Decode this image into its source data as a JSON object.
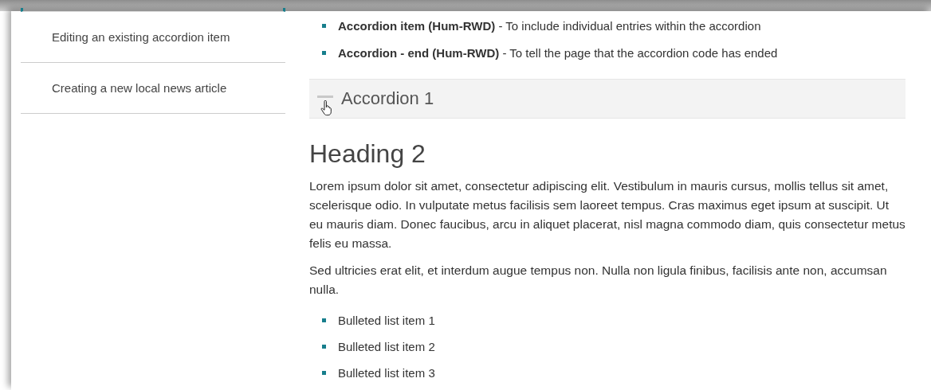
{
  "sidebar": {
    "items": [
      {
        "label": "Editing an existing accordion item",
        "selected": false
      },
      {
        "label": "Creating a new local news article",
        "selected": false
      }
    ]
  },
  "intro_list": [
    "**Accordion item (Hum-RWD)** - To include individual entries within the accordion",
    "**Accordion - end (Hum-RWD)** - To tell the page that the accordion code has ended"
  ],
  "accordion": {
    "title": "Accordion 1",
    "expanded": true,
    "content": {
      "heading": "Heading 2",
      "paragraphs": [
        "Lorem ipsum dolor sit amet, consectetur adipiscing elit. Vestibulum in mauris cursus, mollis tellus sit amet, scelerisque odio. In vulputate metus facilisis sem laoreet tempus. Cras maximus eget ipsum at suscipit. Ut eu mauris diam. Donec faucibus, arcu in aliquet placerat, nisl magna commodo diam, quis consectetur metus felis eu massa.",
        "Sed ultricies erat elit, et interdum augue tempus non. Nulla non ligula finibus, facilisis ante non, accumsan nulla."
      ],
      "bullets": [
        "Bulleted list item 1",
        "Bulleted list item 2",
        "Bulleted list item 3"
      ]
    }
  }
}
